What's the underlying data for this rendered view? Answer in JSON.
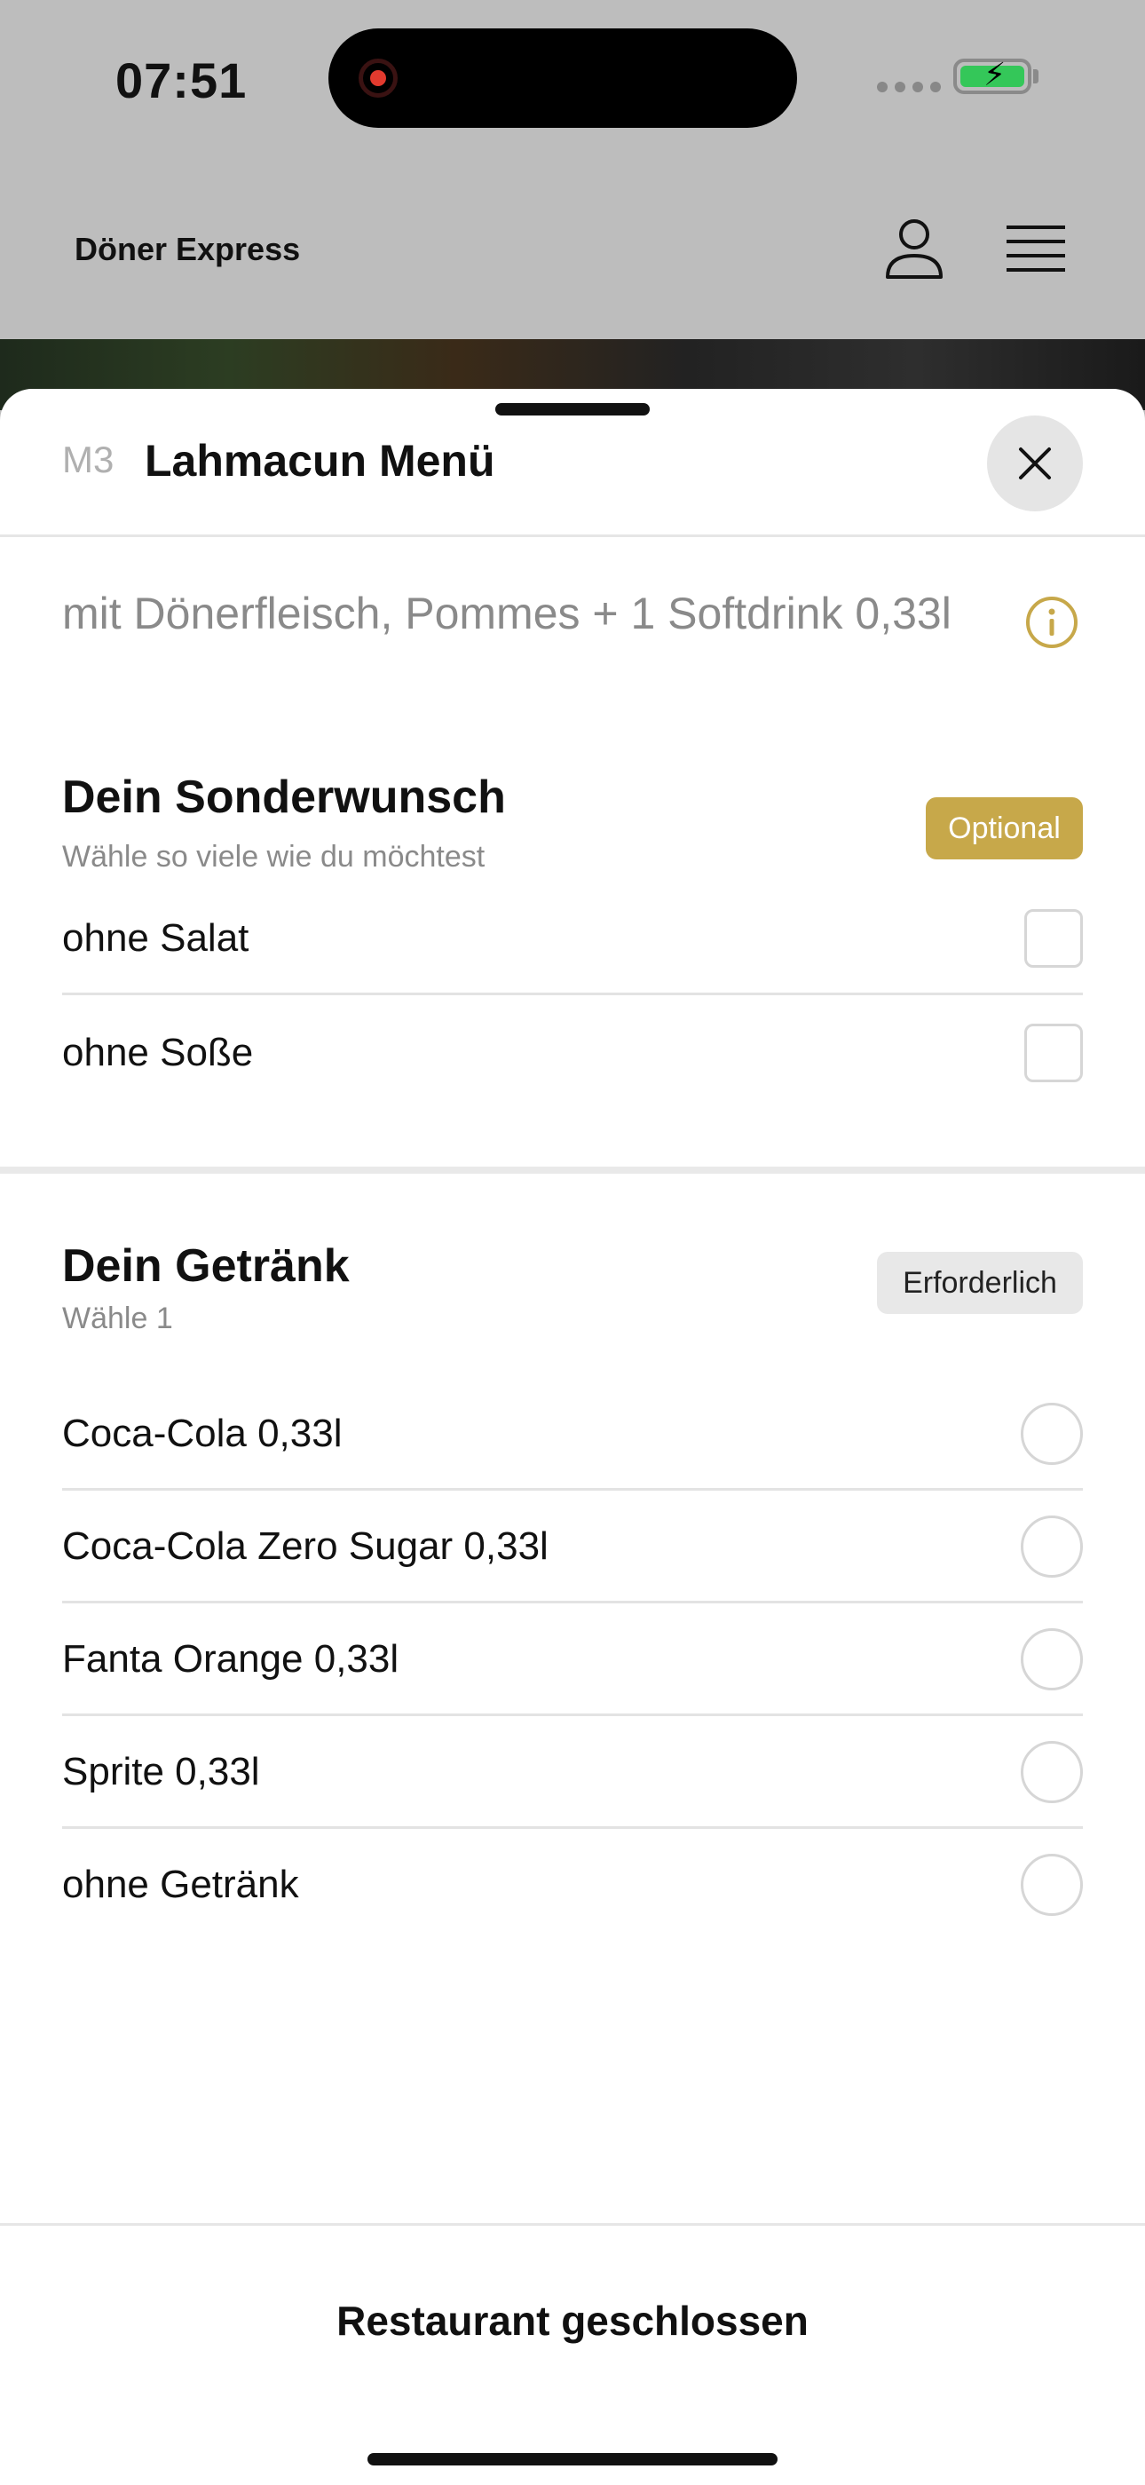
{
  "status_bar": {
    "time": "07:51",
    "recording_indicator": "screen-recording-dot",
    "battery_state": "charging"
  },
  "header": {
    "brand": "Döner Express",
    "user_icon": "user-icon",
    "menu_icon": "hamburger-menu-icon"
  },
  "sheet": {
    "code": "M3",
    "title": "Lahmacun Menü",
    "close_icon": "close-icon",
    "description": "mit Dönerfleisch, Pommes + 1 Softdrink 0,33l",
    "info_icon": "info-icon"
  },
  "section_special": {
    "title": "Dein Sonderwunsch",
    "subtitle": "Wähle so viele wie du möchtest",
    "badge": "Optional",
    "options": [
      {
        "label": "ohne Salat",
        "checked": false
      },
      {
        "label": "ohne Soße",
        "checked": false
      }
    ]
  },
  "section_drink": {
    "title": "Dein Getränk",
    "subtitle": "Wähle 1",
    "badge": "Erforderlich",
    "options": [
      {
        "label": "Coca-Cola 0,33l",
        "selected": false
      },
      {
        "label": "Coca-Cola Zero Sugar 0,33l",
        "selected": false
      },
      {
        "label": "Fanta Orange 0,33l",
        "selected": false
      },
      {
        "label": "Sprite 0,33l",
        "selected": false
      },
      {
        "label": "ohne Getränk",
        "selected": false
      }
    ]
  },
  "footer": {
    "status_label": "Restaurant geschlossen"
  },
  "colors": {
    "accent_gold": "#c7a84a",
    "badge_required_bg": "#e8e8e8",
    "backdrop": "#bdbdbd"
  }
}
